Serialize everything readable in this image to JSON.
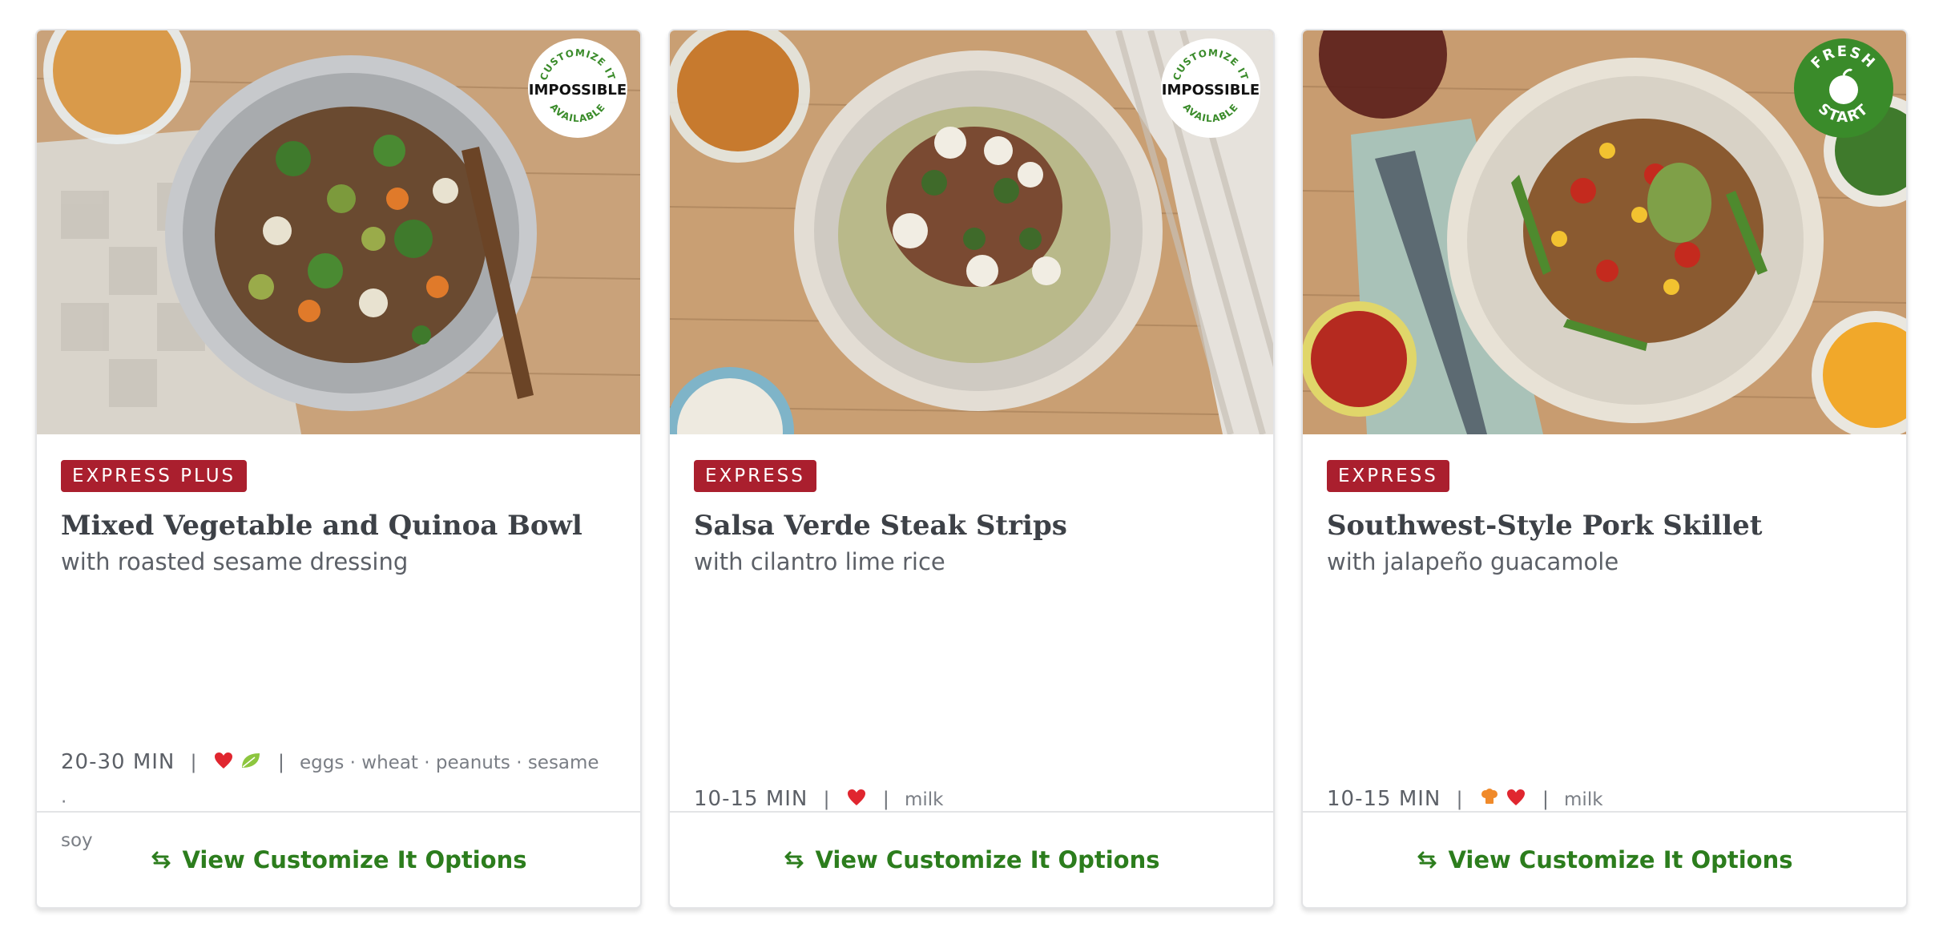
{
  "cards": [
    {
      "tag": "EXPRESS PLUS",
      "title": "Mixed Vegetable and Quinoa Bowl",
      "subtitle": "with roasted sesame dressing",
      "time": "20-30 MIN",
      "icons": [
        "heart-icon",
        "leaf-icon"
      ],
      "allergens": "eggs · wheat · peanuts · sesame ·",
      "allergens_cont": "soy",
      "badge": {
        "top": "CUSTOMIZE IT",
        "middle": "IMPOSSIBLE",
        "bottom": "AVAILABLE"
      },
      "cta": "View Customize It Options"
    },
    {
      "tag": "EXPRESS",
      "title": "Salsa Verde Steak Strips",
      "subtitle": "with cilantro lime rice",
      "time": "10-15 MIN",
      "icons": [
        "heart-icon"
      ],
      "allergens": "milk",
      "badge": {
        "top": "CUSTOMIZE IT",
        "middle": "IMPOSSIBLE",
        "bottom": "AVAILABLE"
      },
      "cta": "View Customize It Options"
    },
    {
      "tag": "EXPRESS",
      "title": "Southwest-Style Pork Skillet",
      "subtitle": "with jalapeño guacamole",
      "time": "10-15 MIN",
      "icons": [
        "chef-hat-icon",
        "heart-icon"
      ],
      "allergens": "milk",
      "badge": {
        "top": "FRESH",
        "bottom": "START"
      },
      "cta": "View Customize It Options"
    }
  ],
  "colors": {
    "tag_bg": "#aa1f2e",
    "cta": "#2c7d1d",
    "heart": "#e0262f",
    "leaf": "#8dc63f",
    "badge_green": "#3a8b2a"
  },
  "separator": "|"
}
